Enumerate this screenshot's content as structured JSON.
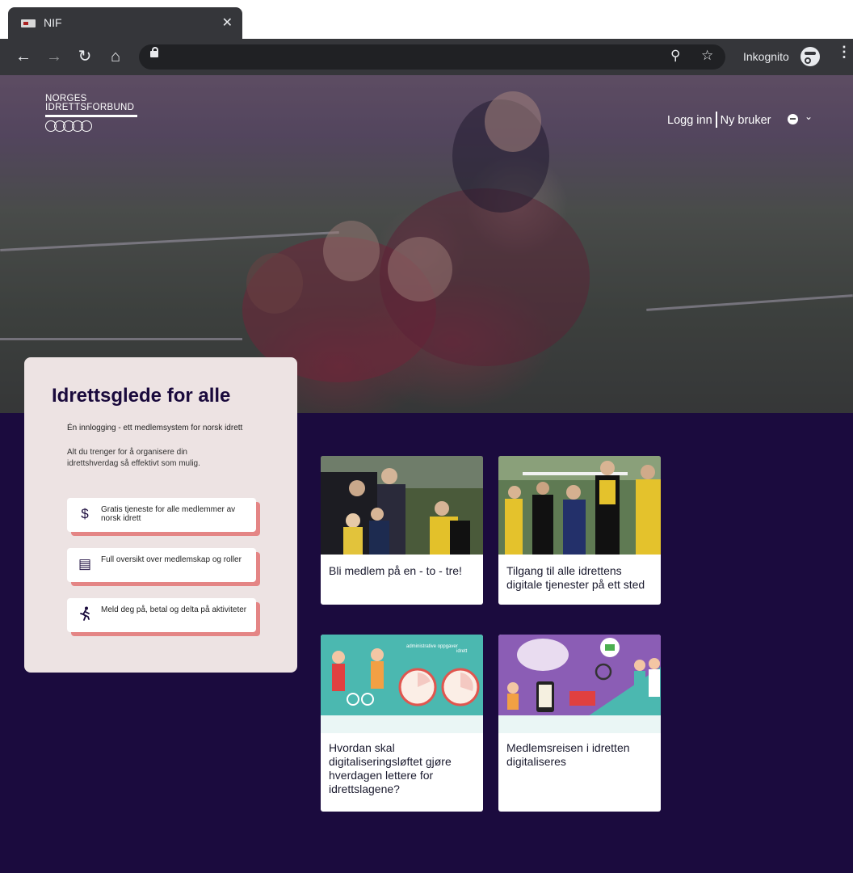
{
  "browser": {
    "tab_title": "NIF",
    "tab_close": "✕",
    "incognito_label": "Inkognito",
    "nav": {
      "back": "←",
      "forward": "→",
      "reload": "↻",
      "home": "⌂",
      "zoom": "⚲",
      "star": "☆",
      "menu": "⋮"
    }
  },
  "header": {
    "logo_lines": [
      "NORGES",
      "IDRETTSFORBUND"
    ],
    "login": "Logg inn",
    "register": "Ny bruker"
  },
  "intro": {
    "title": "Idrettsglede for alle",
    "subtitle": "Én innlogging - ett medlemsystem for norsk idrett",
    "description": "Alt du trenger for å organisere din idrettshverdag så effektivt som mulig.",
    "features": [
      {
        "icon": "dollar-icon",
        "glyph": "$",
        "text": "Gratis tjeneste for alle medlemmer av norsk idrett"
      },
      {
        "icon": "monitor-list-icon",
        "glyph": "▤",
        "text": "Full oversikt over medlemskap og roller"
      },
      {
        "icon": "runner-icon",
        "glyph": "🏃",
        "text": "Meld deg på, betal og delta på aktiviteter"
      }
    ]
  },
  "cards": [
    {
      "title": "Bli medlem på en - to - tre!"
    },
    {
      "title": "Tilgang til alle idrettens digitale tjenester på ett sted"
    },
    {
      "title": "Hvordan skal digitaliseringsløftet gjøre hverdagen lettere for idrettslagene?",
      "img_heading": "administrative oppgaver",
      "img_heading2": "idrett"
    },
    {
      "title": "Medlemsreisen i idretten digitaliseres"
    }
  ],
  "colors": {
    "page_bg": "#1b0b3e",
    "accent": "#e48585",
    "card_bg": "#ede3e3"
  }
}
